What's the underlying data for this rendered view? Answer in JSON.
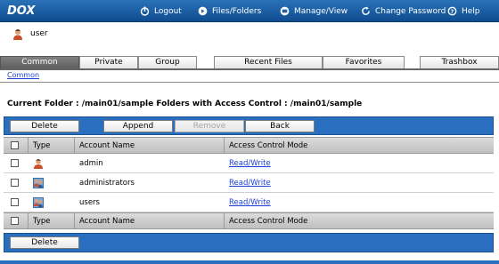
{
  "app": {
    "logo_text": "DOX"
  },
  "nav": {
    "logout": "Logout",
    "files_folders": "Files/Folders",
    "manage_view": "Manage/View",
    "change_password": "Change Password",
    "help": "Help"
  },
  "user": {
    "name": "user"
  },
  "tabs": {
    "common": "Common",
    "private": "Private",
    "group": "Group",
    "recent_files": "Recent Files",
    "favorites": "Favorites",
    "trashbox": "Trashbox"
  },
  "breadcrumb": {
    "common": "Common"
  },
  "folder_info": "Current Folder : /main01/sample  Folders with Access Control : /main01/sample",
  "toolbar_top": {
    "delete": "Delete",
    "append": "Append",
    "remove": "Remove",
    "back": "Back"
  },
  "toolbar_bottom": {
    "delete": "Delete"
  },
  "table": {
    "headers": {
      "type": "Type",
      "account": "Account Name",
      "mode": "Access Control Mode"
    },
    "rows": [
      {
        "type_icon": "user-icon",
        "account": "admin",
        "mode": "Read/Write"
      },
      {
        "type_icon": "group-icon",
        "account": "administrators",
        "mode": "Read/Write"
      },
      {
        "type_icon": "group-icon",
        "account": "users",
        "mode": "Read/Write"
      }
    ]
  },
  "colors": {
    "header_blue": "#1a5ea8",
    "toolbar_blue": "#2a6fbf",
    "active_tab": "#6f6f6f",
    "link": "#1b3fd6"
  }
}
